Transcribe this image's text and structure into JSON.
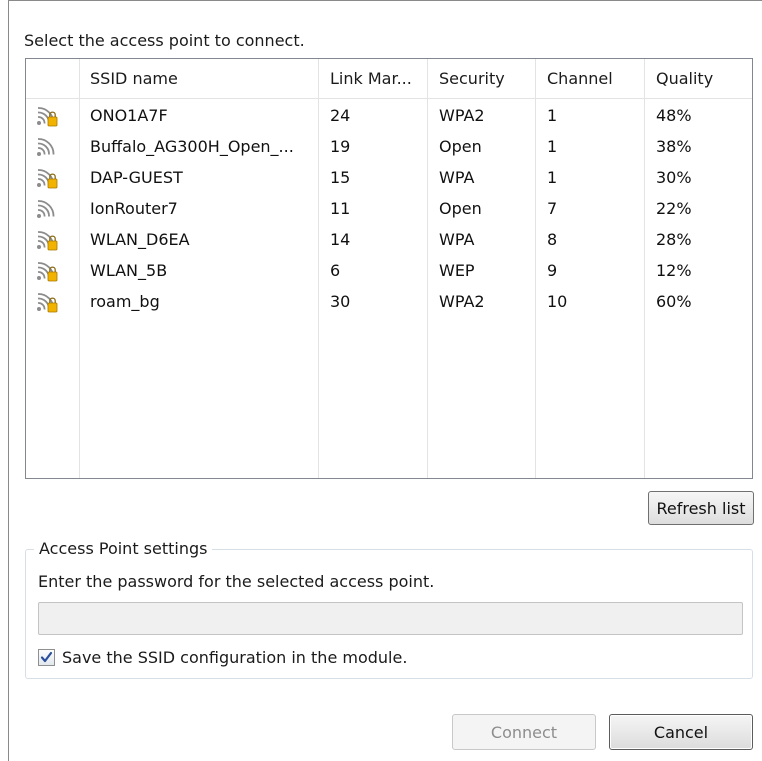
{
  "prompt": "Select the access point to connect.",
  "list": {
    "columns": [
      "SSID name",
      "Link Mar...",
      "Security",
      "Channel",
      "Quality"
    ],
    "rows": [
      {
        "icon": "wifi-lock-icon",
        "ssid": "ONO1A7F",
        "link": "24",
        "security": "WPA2",
        "channel": "1",
        "quality": "48%"
      },
      {
        "icon": "wifi-icon",
        "ssid": "Buffalo_AG300H_Open_...",
        "link": "19",
        "security": "Open",
        "channel": "1",
        "quality": "38%"
      },
      {
        "icon": "wifi-lock-icon",
        "ssid": "DAP-GUEST",
        "link": "15",
        "security": "WPA",
        "channel": "1",
        "quality": "30%"
      },
      {
        "icon": "wifi-icon",
        "ssid": "IonRouter7",
        "link": "11",
        "security": "Open",
        "channel": "7",
        "quality": "22%"
      },
      {
        "icon": "wifi-lock-icon",
        "ssid": "WLAN_D6EA",
        "link": "14",
        "security": "WPA",
        "channel": "8",
        "quality": "28%"
      },
      {
        "icon": "wifi-lock-icon",
        "ssid": "WLAN_5B",
        "link": "6",
        "security": "WEP",
        "channel": "9",
        "quality": "12%"
      },
      {
        "icon": "wifi-lock-icon",
        "ssid": "roam_bg",
        "link": "30",
        "security": "WPA2",
        "channel": "10",
        "quality": "60%"
      }
    ]
  },
  "refresh_label": "Refresh list",
  "settings": {
    "title": "Access Point settings",
    "instruction": "Enter the password for the selected access point.",
    "password_value": "",
    "save_checked": true,
    "save_label": "Save the SSID configuration in the module."
  },
  "buttons": {
    "connect": "Connect",
    "cancel": "Cancel"
  },
  "colors": {
    "signal": "#8c8c8c",
    "lock": "#f2b200",
    "check": "#2b4f9e"
  }
}
